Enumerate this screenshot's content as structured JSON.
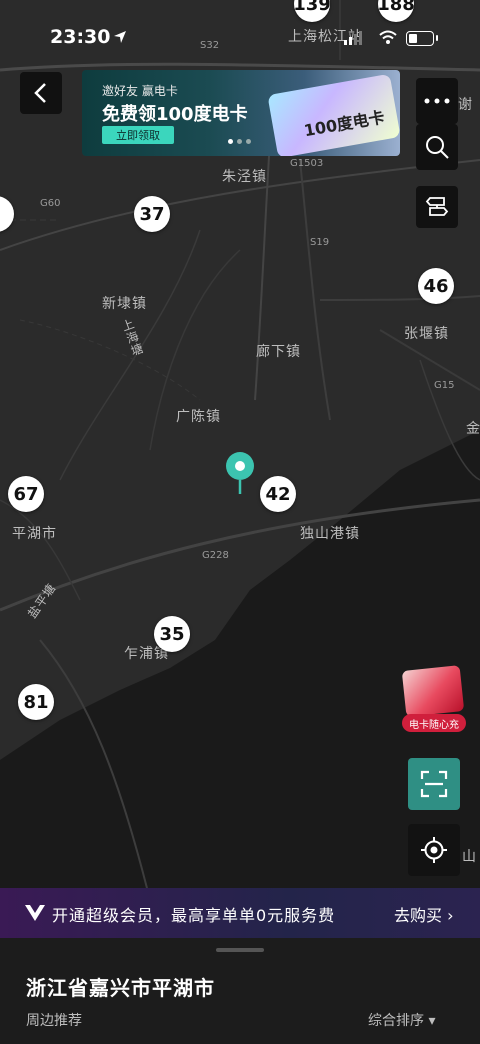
{
  "status": {
    "time": "23:30"
  },
  "banner": {
    "line1": "邀好友 赢电卡",
    "line2": "免费领100度电卡",
    "button": "立即领取",
    "card_text": "100度电卡"
  },
  "map": {
    "places": {
      "shanghai_songjiang": "上海松江站",
      "zhujing": "朱泾镇",
      "xindai": "新埭镇",
      "shanghaitang": "上海塘",
      "langxia": "廊下镇",
      "zhangyan": "张堰镇",
      "guangchen": "广陈镇",
      "pinghu": "平湖市",
      "dushangang": "独山港镇",
      "yanpingtang": "盐平塘",
      "zhapu": "乍浦镇",
      "jin": "金",
      "shan": "山",
      "xie": "谢"
    },
    "roads": {
      "s32": "S32",
      "g1503": "G1503",
      "g60": "G60",
      "s19": "S19",
      "g15": "G15",
      "g228": "G228"
    },
    "stations": [
      {
        "count": "139"
      },
      {
        "count": "188"
      },
      {
        "count": "37"
      },
      {
        "count": "46"
      },
      {
        "count": "67"
      },
      {
        "count": "42"
      },
      {
        "count": "35"
      },
      {
        "count": "81"
      }
    ]
  },
  "side": {
    "promo_label": "电卡随心充"
  },
  "vip": {
    "text": "开通超级会员，最高享单单0元服务费",
    "action": "去购买 ›"
  },
  "sheet": {
    "region": "浙江省嘉兴市平湖市",
    "nearby": "周边推荐",
    "sort": "综合排序 ▾"
  }
}
